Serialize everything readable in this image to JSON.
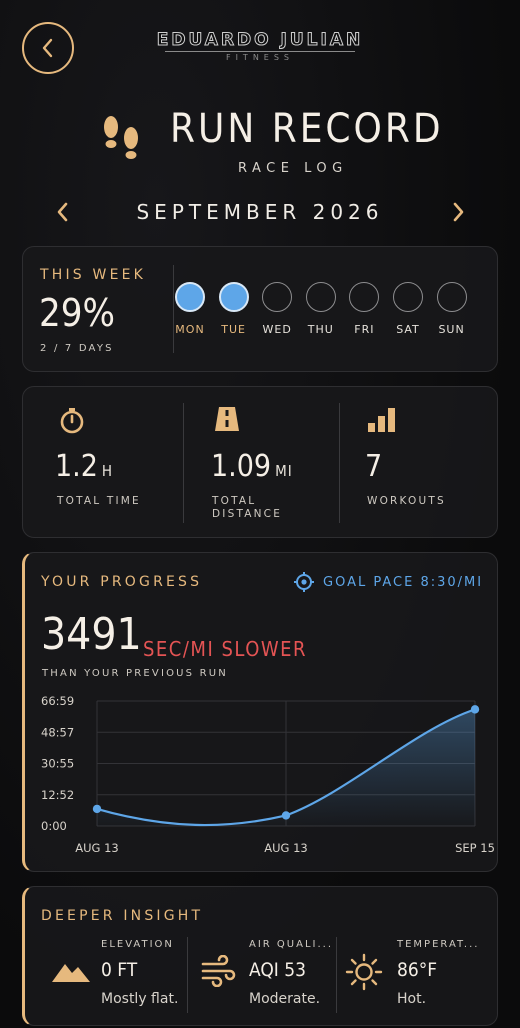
{
  "brand": {
    "name": "EDUARDO JULIAN",
    "sub": "FITNESS"
  },
  "header": {
    "title": "RUN RECORD",
    "subtitle": "RACE LOG"
  },
  "month": {
    "label": "SEPTEMBER 2026"
  },
  "week": {
    "title": "THIS WEEK",
    "percent": "29%",
    "days_text": "2 / 7 DAYS",
    "days": [
      {
        "label": "MON",
        "done": true
      },
      {
        "label": "TUE",
        "done": true
      },
      {
        "label": "WED",
        "done": false
      },
      {
        "label": "THU",
        "done": false
      },
      {
        "label": "FRI",
        "done": false
      },
      {
        "label": "SAT",
        "done": false
      },
      {
        "label": "SUN",
        "done": false
      }
    ]
  },
  "stats": {
    "time": {
      "value": "1.2",
      "unit": "H",
      "label": "TOTAL TIME",
      "icon": "stopwatch-icon"
    },
    "distance": {
      "value": "1.09",
      "unit": "MI",
      "label_line1": "TOTAL",
      "label_line2": "DISTANCE",
      "icon": "road-icon"
    },
    "workouts": {
      "value": "7",
      "label": "WORKOUTS",
      "icon": "bar-chart-icon"
    }
  },
  "progress": {
    "title": "YOUR PROGRESS",
    "goal": "GOAL PACE 8:30/MI",
    "number": "3491",
    "slower_label": "SEC/MI SLOWER",
    "caption": "THAN YOUR PREVIOUS RUN"
  },
  "chart_data": {
    "type": "area",
    "title": "",
    "x": [
      "AUG 13",
      "AUG 13",
      "SEP 15"
    ],
    "series": [
      {
        "values": [
          "9:10",
          "5:40",
          "62:30"
        ]
      }
    ],
    "y_tick_labels": [
      "66:59",
      "48:57",
      "30:55",
      "12:52",
      "0:00"
    ],
    "x_tick_labels": [
      "AUG 13",
      "AUG 13",
      "SEP 15"
    ],
    "ylim": [
      "0:00",
      "66:59"
    ],
    "grid": true,
    "color": "#5ea6e8"
  },
  "insight": {
    "title": "DEEPER INSIGHT",
    "items": [
      {
        "title": "ELEVATION",
        "value": "0 FT",
        "desc": "Mostly flat.",
        "icon": "mountain-icon"
      },
      {
        "title": "AIR QUALI...",
        "value": "AQI 53",
        "desc": "Moderate.",
        "icon": "wind-icon"
      },
      {
        "title": "TEMPERAT...",
        "value": "86°F",
        "desc": "Hot.",
        "icon": "sun-icon"
      }
    ]
  },
  "colors": {
    "accent": "#e6b97e",
    "blue": "#5ea6e8",
    "red": "#e45454"
  }
}
